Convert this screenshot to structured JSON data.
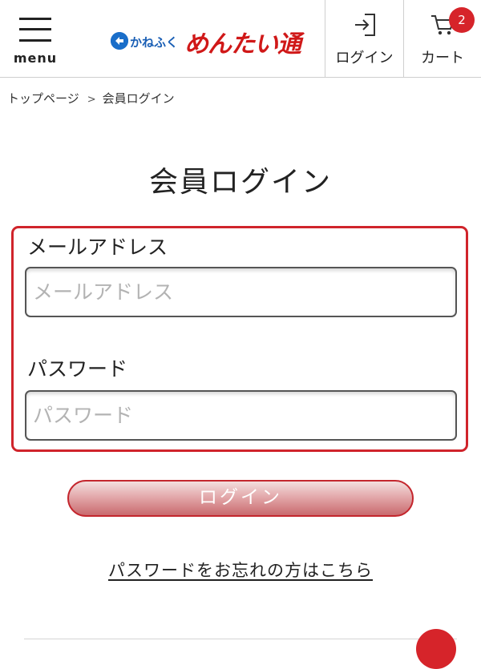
{
  "header": {
    "menu_label": "menu",
    "logo_kana": "かねふく",
    "logo_brand": "めんたい通",
    "login_label": "ログイン",
    "cart_label": "カート",
    "cart_count": "2"
  },
  "breadcrumb": {
    "home": "トップページ",
    "separator": ">",
    "current": "会員ログイン"
  },
  "page": {
    "title": "会員ログイン"
  },
  "form": {
    "email_label": "メールアドレス",
    "email_value": "",
    "email_placeholder": "メールアドレス",
    "password_label": "パスワード",
    "password_value": "",
    "password_placeholder": "パスワード",
    "submit_label": "ログイン",
    "forgot_link": "パスワードをお忘れの方はこちら"
  },
  "colors": {
    "accent": "#d0242b",
    "brand_blue": "#1a6ec9"
  },
  "icons": {
    "menu": "hamburger-icon",
    "login": "login-icon",
    "cart": "cart-icon",
    "logo": "brand-mark-icon"
  }
}
